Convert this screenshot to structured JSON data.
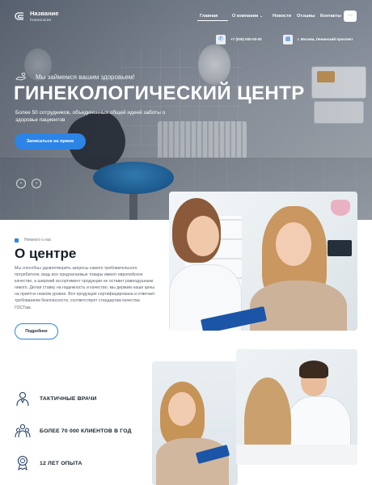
{
  "header": {
    "logo_title": "Название",
    "logo_subtitle": "Гинекология",
    "nav": [
      {
        "label": "Главная",
        "active": true
      },
      {
        "label": "О компании",
        "dropdown": true
      },
      {
        "label": "Новости"
      },
      {
        "label": "Отзывы"
      },
      {
        "label": "Контакты"
      }
    ],
    "menu_icon": "ellipsis-icon",
    "phone": "+7 (000) 000-00-00",
    "address": "г. Москва, Ленинский проспект"
  },
  "hero": {
    "tagline": "Мы займемся вашим здоровьем!",
    "title": "ГИНЕКОЛОГИЧЕСКИЙ ЦЕНТР",
    "description": "Более 50 сотрудников, объединенных общей идеей заботы о здоровье пациентов",
    "cta_label": "Записаться на прием",
    "prev_arrow": "‹",
    "next_arrow": "›"
  },
  "about": {
    "label": "Немного о нас",
    "title": "О центре",
    "text": "Мы способны удовлетворить запросы самого требовательного потребителя, ведь все предлагаемые товары имеют европейское качество, а широкий ассортимент продукции не оставит равнодушным никого. Делая ставку на надежность и качество, мы держим наши цены на приятно низком уровне. Вся продукция сертифицирована и отвечает требованиям безопасности, соответствует стандартам качества ГОСТам.",
    "more_label": "Подробнее"
  },
  "features": [
    {
      "icon": "doctor-icon",
      "label": "ТАКТИЧНЫЕ ВРАЧИ"
    },
    {
      "icon": "clients-icon",
      "label": "БОЛЕЕ 70 000 КЛИЕНТОВ В ГОД"
    },
    {
      "icon": "award-icon",
      "label": "12 ЛЕТ ОПЫТА"
    }
  ],
  "colors": {
    "accent": "#2b84e6",
    "dark": "#16202c"
  }
}
